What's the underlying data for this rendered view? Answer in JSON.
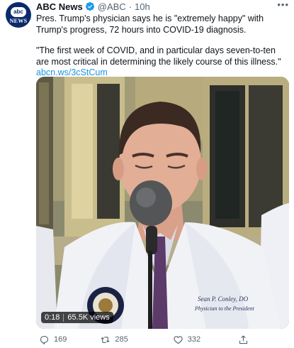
{
  "author": {
    "name": "ABC News",
    "handle": "@ABC",
    "dot": "·",
    "time": "10h",
    "avatar_text_top": "abc",
    "avatar_text_bottom": "NEWS"
  },
  "more_glyph": "•••",
  "tweet": {
    "paragraph1": "Pres. Trump's physician says he is \"extremely happy\" with Trump's progress, 72 hours into COVID-19 diagnosis.",
    "paragraph2": "\"The first week of COVID, and in particular days seven-to-ten are most critical in determining the likely course of this illness.\"",
    "link": "abcn.ws/3cStCum"
  },
  "video": {
    "duration": "0:18",
    "views": "65.5K views",
    "coat_name_line1": "Sean P. Conley, DO",
    "coat_name_line2": "Physician to the President"
  },
  "actions": {
    "replies": "169",
    "retweets": "285",
    "likes": "332"
  },
  "colors": {
    "link": "#1b95e0",
    "verified": "#1d9bf0",
    "secondary_text": "#536471"
  }
}
